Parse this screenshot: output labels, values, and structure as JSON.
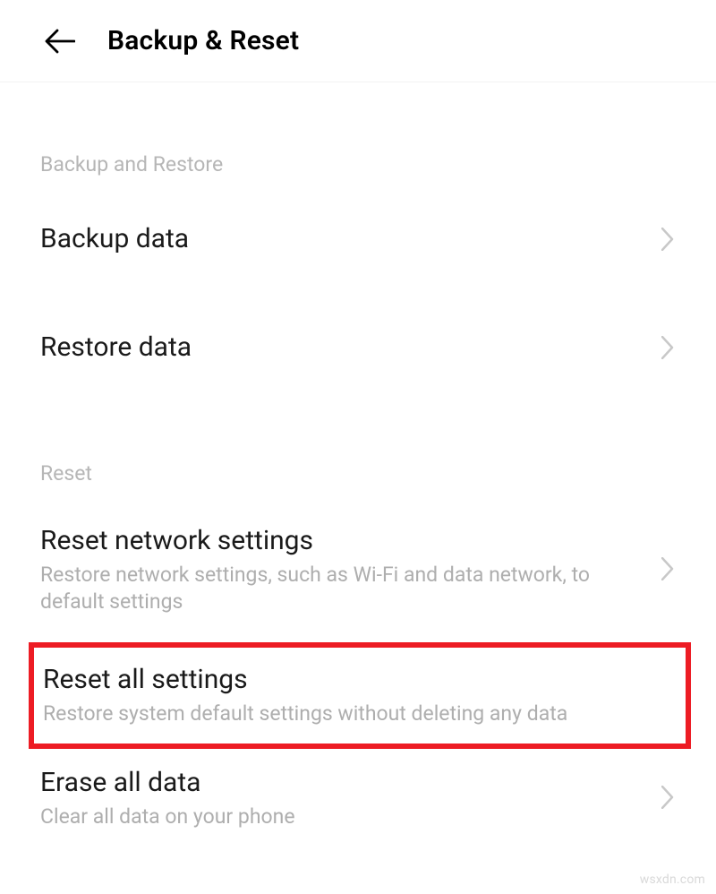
{
  "header": {
    "title": "Backup & Reset"
  },
  "sections": {
    "backup": {
      "header": "Backup and Restore",
      "items": {
        "backup_data": {
          "label": "Backup data"
        },
        "restore_data": {
          "label": "Restore data"
        }
      }
    },
    "reset": {
      "header": "Reset",
      "items": {
        "reset_network": {
          "label": "Reset network settings",
          "desc": "Restore network settings, such as Wi-Fi and data network, to default settings"
        },
        "reset_all": {
          "label": "Reset all settings",
          "desc": "Restore system default settings without deleting any data"
        },
        "erase_all": {
          "label": "Erase all data",
          "desc": "Clear all data on your phone"
        }
      }
    }
  },
  "watermark": "wsxdn.com"
}
